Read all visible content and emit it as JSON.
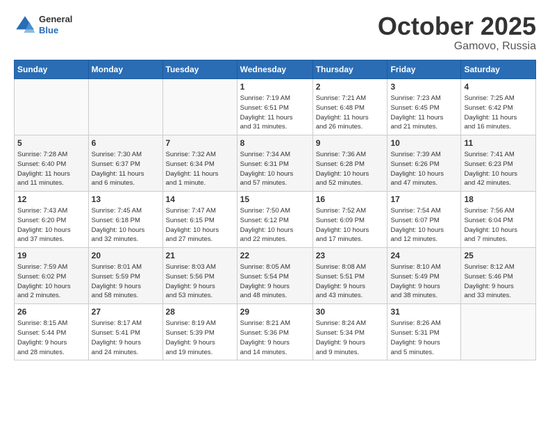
{
  "header": {
    "logo_general": "General",
    "logo_blue": "Blue",
    "month": "October 2025",
    "location": "Gamovo, Russia"
  },
  "weekdays": [
    "Sunday",
    "Monday",
    "Tuesday",
    "Wednesday",
    "Thursday",
    "Friday",
    "Saturday"
  ],
  "weeks": [
    [
      {
        "day": "",
        "info": ""
      },
      {
        "day": "",
        "info": ""
      },
      {
        "day": "",
        "info": ""
      },
      {
        "day": "1",
        "info": "Sunrise: 7:19 AM\nSunset: 6:51 PM\nDaylight: 11 hours\nand 31 minutes."
      },
      {
        "day": "2",
        "info": "Sunrise: 7:21 AM\nSunset: 6:48 PM\nDaylight: 11 hours\nand 26 minutes."
      },
      {
        "day": "3",
        "info": "Sunrise: 7:23 AM\nSunset: 6:45 PM\nDaylight: 11 hours\nand 21 minutes."
      },
      {
        "day": "4",
        "info": "Sunrise: 7:25 AM\nSunset: 6:42 PM\nDaylight: 11 hours\nand 16 minutes."
      }
    ],
    [
      {
        "day": "5",
        "info": "Sunrise: 7:28 AM\nSunset: 6:40 PM\nDaylight: 11 hours\nand 11 minutes."
      },
      {
        "day": "6",
        "info": "Sunrise: 7:30 AM\nSunset: 6:37 PM\nDaylight: 11 hours\nand 6 minutes."
      },
      {
        "day": "7",
        "info": "Sunrise: 7:32 AM\nSunset: 6:34 PM\nDaylight: 11 hours\nand 1 minute."
      },
      {
        "day": "8",
        "info": "Sunrise: 7:34 AM\nSunset: 6:31 PM\nDaylight: 10 hours\nand 57 minutes."
      },
      {
        "day": "9",
        "info": "Sunrise: 7:36 AM\nSunset: 6:28 PM\nDaylight: 10 hours\nand 52 minutes."
      },
      {
        "day": "10",
        "info": "Sunrise: 7:39 AM\nSunset: 6:26 PM\nDaylight: 10 hours\nand 47 minutes."
      },
      {
        "day": "11",
        "info": "Sunrise: 7:41 AM\nSunset: 6:23 PM\nDaylight: 10 hours\nand 42 minutes."
      }
    ],
    [
      {
        "day": "12",
        "info": "Sunrise: 7:43 AM\nSunset: 6:20 PM\nDaylight: 10 hours\nand 37 minutes."
      },
      {
        "day": "13",
        "info": "Sunrise: 7:45 AM\nSunset: 6:18 PM\nDaylight: 10 hours\nand 32 minutes."
      },
      {
        "day": "14",
        "info": "Sunrise: 7:47 AM\nSunset: 6:15 PM\nDaylight: 10 hours\nand 27 minutes."
      },
      {
        "day": "15",
        "info": "Sunrise: 7:50 AM\nSunset: 6:12 PM\nDaylight: 10 hours\nand 22 minutes."
      },
      {
        "day": "16",
        "info": "Sunrise: 7:52 AM\nSunset: 6:09 PM\nDaylight: 10 hours\nand 17 minutes."
      },
      {
        "day": "17",
        "info": "Sunrise: 7:54 AM\nSunset: 6:07 PM\nDaylight: 10 hours\nand 12 minutes."
      },
      {
        "day": "18",
        "info": "Sunrise: 7:56 AM\nSunset: 6:04 PM\nDaylight: 10 hours\nand 7 minutes."
      }
    ],
    [
      {
        "day": "19",
        "info": "Sunrise: 7:59 AM\nSunset: 6:02 PM\nDaylight: 10 hours\nand 2 minutes."
      },
      {
        "day": "20",
        "info": "Sunrise: 8:01 AM\nSunset: 5:59 PM\nDaylight: 9 hours\nand 58 minutes."
      },
      {
        "day": "21",
        "info": "Sunrise: 8:03 AM\nSunset: 5:56 PM\nDaylight: 9 hours\nand 53 minutes."
      },
      {
        "day": "22",
        "info": "Sunrise: 8:05 AM\nSunset: 5:54 PM\nDaylight: 9 hours\nand 48 minutes."
      },
      {
        "day": "23",
        "info": "Sunrise: 8:08 AM\nSunset: 5:51 PM\nDaylight: 9 hours\nand 43 minutes."
      },
      {
        "day": "24",
        "info": "Sunrise: 8:10 AM\nSunset: 5:49 PM\nDaylight: 9 hours\nand 38 minutes."
      },
      {
        "day": "25",
        "info": "Sunrise: 8:12 AM\nSunset: 5:46 PM\nDaylight: 9 hours\nand 33 minutes."
      }
    ],
    [
      {
        "day": "26",
        "info": "Sunrise: 8:15 AM\nSunset: 5:44 PM\nDaylight: 9 hours\nand 28 minutes."
      },
      {
        "day": "27",
        "info": "Sunrise: 8:17 AM\nSunset: 5:41 PM\nDaylight: 9 hours\nand 24 minutes."
      },
      {
        "day": "28",
        "info": "Sunrise: 8:19 AM\nSunset: 5:39 PM\nDaylight: 9 hours\nand 19 minutes."
      },
      {
        "day": "29",
        "info": "Sunrise: 8:21 AM\nSunset: 5:36 PM\nDaylight: 9 hours\nand 14 minutes."
      },
      {
        "day": "30",
        "info": "Sunrise: 8:24 AM\nSunset: 5:34 PM\nDaylight: 9 hours\nand 9 minutes."
      },
      {
        "day": "31",
        "info": "Sunrise: 8:26 AM\nSunset: 5:31 PM\nDaylight: 9 hours\nand 5 minutes."
      },
      {
        "day": "",
        "info": ""
      }
    ]
  ]
}
